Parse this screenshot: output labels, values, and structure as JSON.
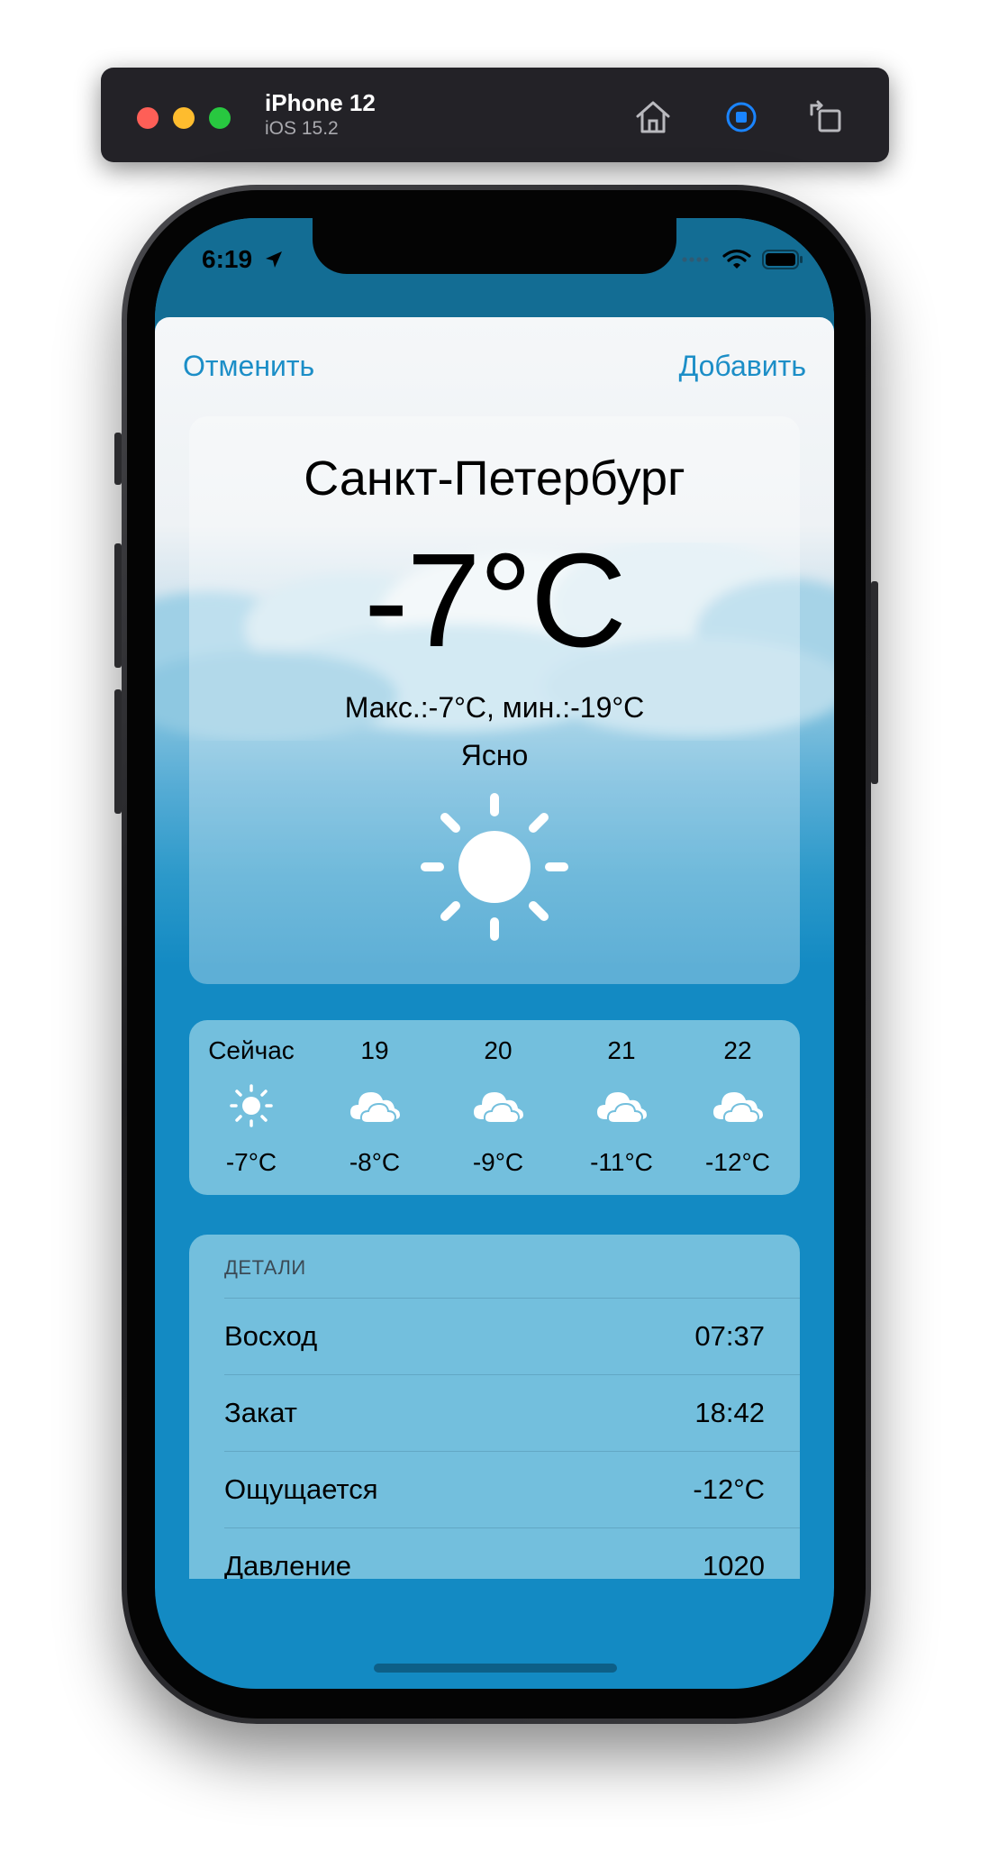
{
  "simulator": {
    "device": "iPhone 12",
    "os": "iOS 15.2",
    "icons": [
      "home-icon",
      "screenshot-icon",
      "rotate-icon"
    ]
  },
  "status_bar": {
    "time": "6:19",
    "icons": [
      "location-arrow-icon",
      "cellular-icon",
      "wifi-icon",
      "battery-icon"
    ]
  },
  "nav": {
    "cancel_label": "Отменить",
    "add_label": "Добавить",
    "accent": "#1c8ec7"
  },
  "current": {
    "city": "Санкт-Петербург",
    "temperature": "-7°C",
    "minmax": "Макс.:-7°C, мин.:-19°C",
    "condition": "Ясно",
    "icon": "sun-icon"
  },
  "hourly": [
    {
      "label": "Сейчас",
      "icon": "sun-icon",
      "temp": "-7°C"
    },
    {
      "label": "19",
      "icon": "cloud-icon",
      "temp": "-8°C"
    },
    {
      "label": "20",
      "icon": "cloud-icon",
      "temp": "-9°C"
    },
    {
      "label": "21",
      "icon": "cloud-icon",
      "temp": "-11°C"
    },
    {
      "label": "22",
      "icon": "cloud-icon",
      "temp": "-12°C"
    }
  ],
  "details": {
    "header": "ДЕТАЛИ",
    "rows": [
      {
        "label": "Восход",
        "value": "07:37"
      },
      {
        "label": "Закат",
        "value": "18:42"
      },
      {
        "label": "Ощущается",
        "value": "-12°C"
      },
      {
        "label": "Давление",
        "value": "1020"
      }
    ]
  },
  "colors": {
    "background_blue": "#138ac3",
    "card_blue": "#73bfdd"
  }
}
